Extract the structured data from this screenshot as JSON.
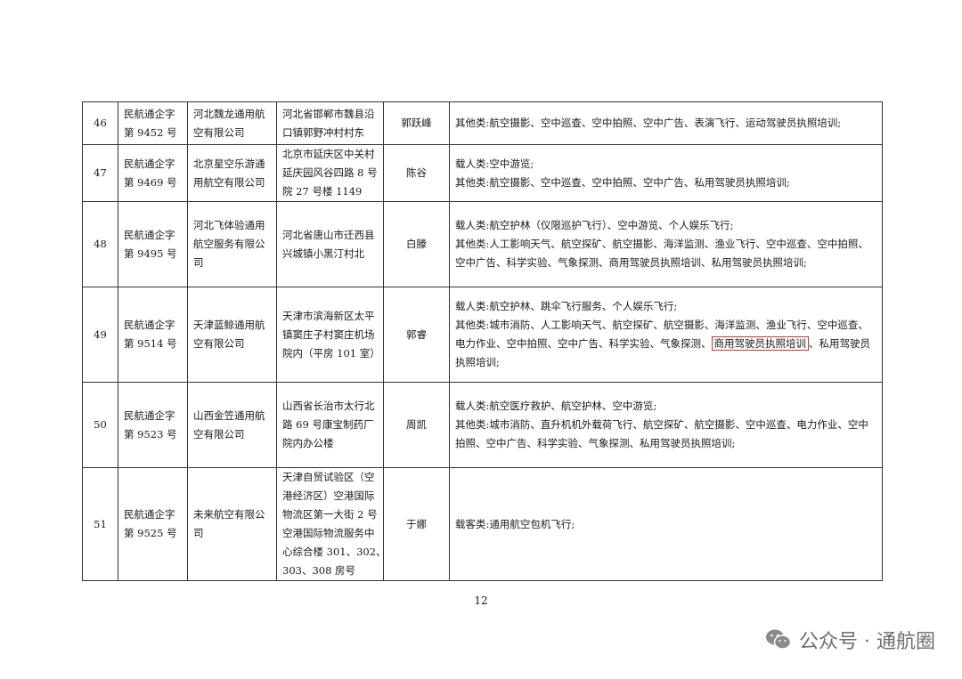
{
  "rows": [
    {
      "no": "46",
      "license": [
        "民航通企字",
        "第 9452 号"
      ],
      "company": [
        "河北魏龙通用航",
        "空有限公司"
      ],
      "address": [
        "河北省邯郸市魏县沿",
        "口镇郭野冲村村东"
      ],
      "legal_rep": "郭跃峰",
      "scope": [
        "其他类:航空摄影、空中巡查、空中拍照、空中广告、表演飞行、运动驾驶员执照培训;"
      ]
    },
    {
      "no": "47",
      "license": [
        "民航通企字",
        "第 9469 号"
      ],
      "company": [
        "北京星空乐游通",
        "用航空有限公司"
      ],
      "address": [
        "北京市延庆区中关村",
        "延庆园风谷四路 8 号",
        "院 27 号楼 1149"
      ],
      "legal_rep": "陈谷",
      "scope": [
        "载人类:空中游览;",
        "其他类:航空摄影、空中巡查、空中拍照、空中广告、私用驾驶员执照培训;"
      ]
    },
    {
      "no": "48",
      "license": [
        "民航通企字",
        "第 9495 号"
      ],
      "company": [
        "河北飞体验通用",
        "航空服务有限公",
        "司"
      ],
      "address": [
        "河北省唐山市迁西县",
        "兴城镇小黑汀村北"
      ],
      "legal_rep": "白滕",
      "scope": [
        "载人类:航空护林（仪限巡护飞行）、空中游览、个人娱乐飞行;",
        "其他类:人工影响天气、航空探矿、航空摄影、海洋监测、渔业飞行、空中巡查、空中拍照、",
        "空中广告、科学实验、气象探测、商用驾驶员执照培训、私用驾驶员执照培训;"
      ]
    },
    {
      "no": "49",
      "license": [
        "民航通企字",
        "第 9514 号"
      ],
      "company": [
        "天津蓝鲸通用航",
        "空有限公司"
      ],
      "address": [
        "天津市滨海新区太平",
        "镇窦庄子村窦庄机场",
        "院内（平房 101 室）"
      ],
      "legal_rep": "郭睿",
      "scope_lines": {
        "l1": "载人类:航空护林、跳伞飞行服务、个人娱乐飞行;",
        "l2": "其他类:城市消防、人工影响天气、航空探矿、航空摄影、海洋监测、渔业飞行、空中巡查、",
        "l3_pre": "电力作业、空中拍照、空中广告、科学实验、气象探测、",
        "l3_hl": "商用驾驶员执照培训",
        "l3_post": "、私用驾驶员",
        "l4": "执照培训;"
      }
    },
    {
      "no": "50",
      "license": [
        "民航通企字",
        "第 9523 号"
      ],
      "company": [
        "山西金笠通用航",
        "空有限公司"
      ],
      "address": [
        "山西省长治市太行北",
        "路 69 号康宝制药厂",
        "院内办公楼"
      ],
      "legal_rep": "周凯",
      "scope": [
        "载人类:航空医疗救护、航空护林、空中游览;",
        "其他类:城市消防、直升机机外载荷飞行、航空探矿、航空摄影、空中巡查、电力作业、空中",
        "拍照、空中广告、科学实验、气象探测、私用驾驶员执照培训;"
      ]
    },
    {
      "no": "51",
      "license": [
        "民航通企字",
        "第 9525 号"
      ],
      "company": [
        "未来航空有限公",
        "司"
      ],
      "address": [
        "天津自贸试验区（空",
        "港经济区）空港国际",
        "物流区第一大街 2 号",
        "空港国际物流服务中",
        "心综合楼 301、302、",
        "303、308 房号"
      ],
      "legal_rep": "于娜",
      "scope": [
        "载客类:通用航空包机飞行;"
      ]
    }
  ],
  "page_number": "12",
  "watermark": {
    "icon": "wechat-icon",
    "text": "公众号 · 通航圈"
  },
  "colors": {
    "highlight_border": "#d32f2f",
    "grid": "#333333"
  }
}
